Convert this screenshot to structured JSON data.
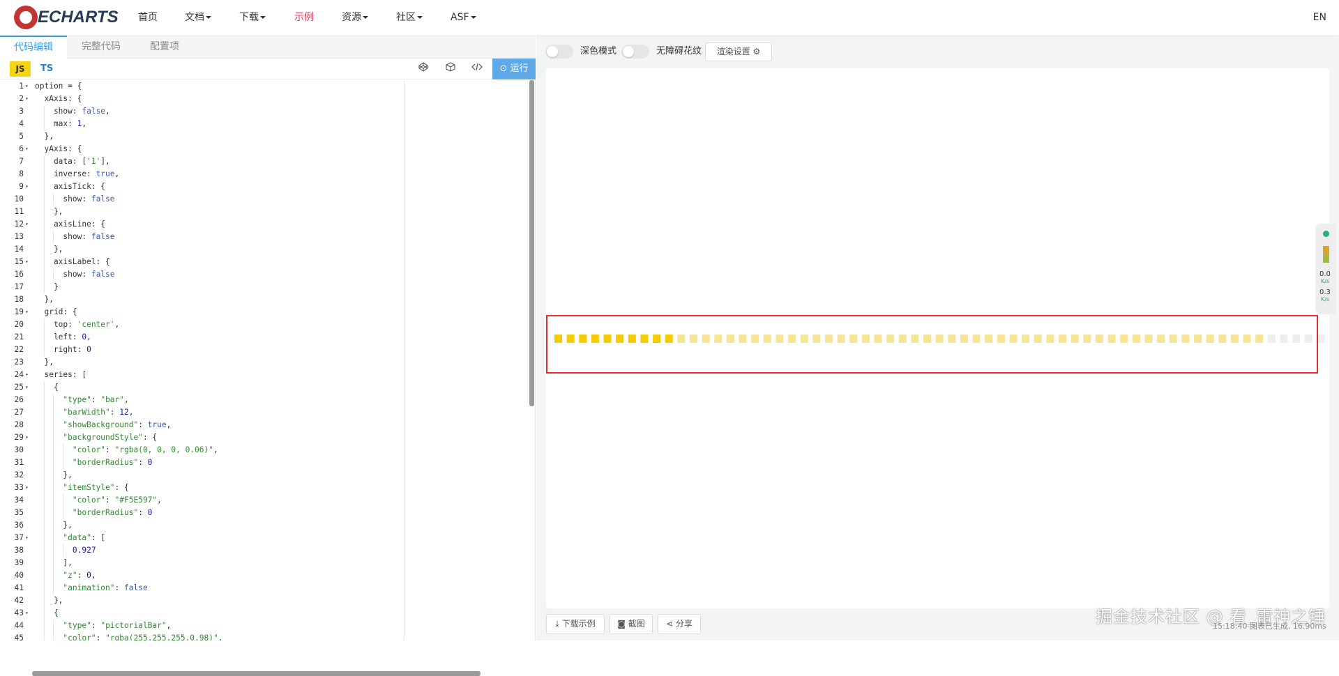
{
  "nav": {
    "logo_text": "ECHARTS",
    "items": [
      {
        "label": "首页",
        "dropdown": false,
        "active": false
      },
      {
        "label": "文档",
        "dropdown": true,
        "active": false
      },
      {
        "label": "下载",
        "dropdown": true,
        "active": false
      },
      {
        "label": "示例",
        "dropdown": false,
        "active": true
      },
      {
        "label": "资源",
        "dropdown": true,
        "active": false
      },
      {
        "label": "社区",
        "dropdown": true,
        "active": false
      },
      {
        "label": "ASF",
        "dropdown": true,
        "active": false
      }
    ],
    "lang": "EN",
    "brand_color": "#c23531",
    "active_color": "#e43c59"
  },
  "editor": {
    "tabs": [
      "代码编辑",
      "完整代码",
      "配置项"
    ],
    "js_label": "JS",
    "ts_label": "TS",
    "run_label": "运行",
    "tool_icons": [
      "codepen-icon",
      "codesandbox-icon",
      "code-icon"
    ],
    "lines": [
      "option = {",
      "  xAxis: {",
      "    show: false,",
      "    max: 1,",
      "  },",
      "  yAxis: {",
      "    data: ['1'],",
      "    inverse: true,",
      "    axisTick: {",
      "      show: false",
      "    },",
      "    axisLine: {",
      "      show: false",
      "    },",
      "    axisLabel: {",
      "      show: false",
      "    }",
      "  },",
      "  grid: {",
      "    top: 'center',",
      "    left: 0,",
      "    right: 0",
      "  },",
      "  series: [",
      "    {",
      "      \"type\": \"bar\",",
      "      \"barWidth\": 12,",
      "      \"showBackground\": true,",
      "      \"backgroundStyle\": {",
      "        \"color\": \"rgba(0, 0, 0, 0.06)\",",
      "        \"borderRadius\": 0",
      "      },",
      "      \"itemStyle\": {",
      "        \"color\": \"#F5E597\",",
      "        \"borderRadius\": 0",
      "      },",
      "      \"data\": [",
      "        0.927",
      "      ],",
      "      \"z\": 0,",
      "      \"animation\": false",
      "    },",
      "    {",
      "      \"type\": \"pictorialBar\",",
      "      \"color\": \"rgba(255,255,255,0.98)\","
    ],
    "fold_lines": [
      1,
      2,
      6,
      9,
      12,
      15,
      19,
      24,
      25,
      29,
      33,
      37,
      43
    ]
  },
  "preview": {
    "dark_mode_label": "深色模式",
    "accessibility_label": "无障碍花纹",
    "render_settings_label": "渲染设置",
    "download_label": "下载示例",
    "screenshot_label": "截图",
    "share_label": "分享",
    "watermark": "掘金技术社区 @ 看_雷神之锤",
    "status": "15:18:40  图表已生成, 16.90ms",
    "side_widget_values": [
      "0.0",
      "K/s",
      "0.3",
      "K/s"
    ]
  },
  "chart_data": {
    "type": "bar",
    "bar_value": 0.927,
    "xmax": 1,
    "segments_total": 63,
    "segments_strong": 10,
    "colors": {
      "strong": "#f5cc00",
      "fill": "#F5E597",
      "background": "rgba(0, 0, 0, 0.06)",
      "highlight_border": "#e42c2c"
    }
  }
}
